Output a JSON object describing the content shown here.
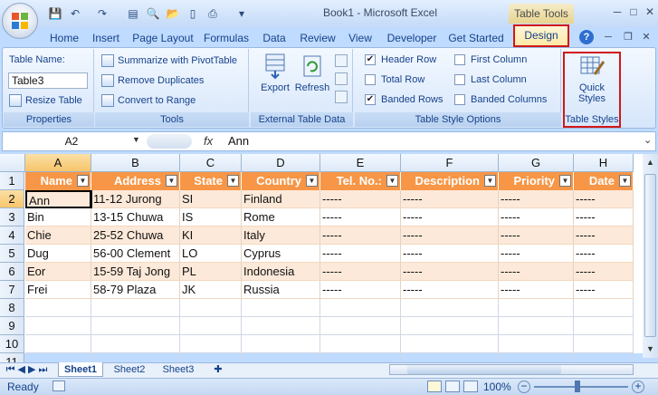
{
  "window": {
    "title": "Book1 - Microsoft Excel",
    "context_label": "Table Tools"
  },
  "tabs": [
    "Home",
    "Insert",
    "Page Layout",
    "Formulas",
    "Data",
    "Review",
    "View",
    "Developer",
    "Get Started"
  ],
  "active_tab": "Design",
  "ribbon": {
    "properties": {
      "table_name_label": "Table Name:",
      "table_name_value": "Table3",
      "resize_label": "Resize Table",
      "group_label": "Properties"
    },
    "tools": {
      "items": [
        "Summarize with PivotTable",
        "Remove Duplicates",
        "Convert to Range"
      ],
      "group_label": "Tools"
    },
    "external": {
      "export_label": "Export",
      "refresh_label": "Refresh",
      "group_label": "External Table Data"
    },
    "options": {
      "col1": [
        {
          "label": "Header Row",
          "checked": true
        },
        {
          "label": "Total Row",
          "checked": false
        },
        {
          "label": "Banded Rows",
          "checked": true
        }
      ],
      "col2": [
        {
          "label": "First Column",
          "checked": false
        },
        {
          "label": "Last Column",
          "checked": false
        },
        {
          "label": "Banded Columns",
          "checked": false
        }
      ],
      "group_label": "Table Style Options"
    },
    "styles": {
      "quick_label_1": "Quick",
      "quick_label_2": "Styles",
      "group_label": "Table Styles"
    }
  },
  "formula_bar": {
    "name_box": "A2",
    "fx": "fx",
    "content": "Ann"
  },
  "columns": [
    "A",
    "B",
    "C",
    "D",
    "E",
    "F",
    "G",
    "H"
  ],
  "rows": [
    "1",
    "2",
    "3",
    "4",
    "5",
    "6",
    "7",
    "8",
    "9",
    "10",
    "11"
  ],
  "table": {
    "headers": [
      "Name",
      "Address",
      "State",
      "Country",
      "Tel. No.:",
      "Description",
      "Priority",
      "Date"
    ],
    "data": [
      [
        "Ann",
        "11-12 Jurong",
        "SI",
        "Finland",
        "-----",
        "-----",
        "-----",
        "-----"
      ],
      [
        "Bin",
        "13-15 Chuwa",
        "IS",
        "Rome",
        "-----",
        "-----",
        "-----",
        "-----"
      ],
      [
        "Chie",
        "25-52 Chuwa",
        "KI",
        "Italy",
        "-----",
        "-----",
        "-----",
        "-----"
      ],
      [
        "Dug",
        "56-00 Clement",
        "LO",
        "Cyprus",
        "-----",
        "-----",
        "-----",
        "-----"
      ],
      [
        "Eor",
        "15-59 Taj Jong",
        "PL",
        "Indonesia",
        "-----",
        "-----",
        "-----",
        "-----"
      ],
      [
        "Frei",
        "58-79 Plaza",
        "JK",
        "Russia",
        "-----",
        "-----",
        "-----",
        "-----"
      ]
    ]
  },
  "sheets": [
    "Sheet1",
    "Sheet2",
    "Sheet3"
  ],
  "active_sheet": "Sheet1",
  "status": {
    "ready": "Ready",
    "zoom": "100%"
  },
  "colors": {
    "header_orange": "#f79646",
    "band": "#fde9d9",
    "highlight": "#d01818"
  }
}
